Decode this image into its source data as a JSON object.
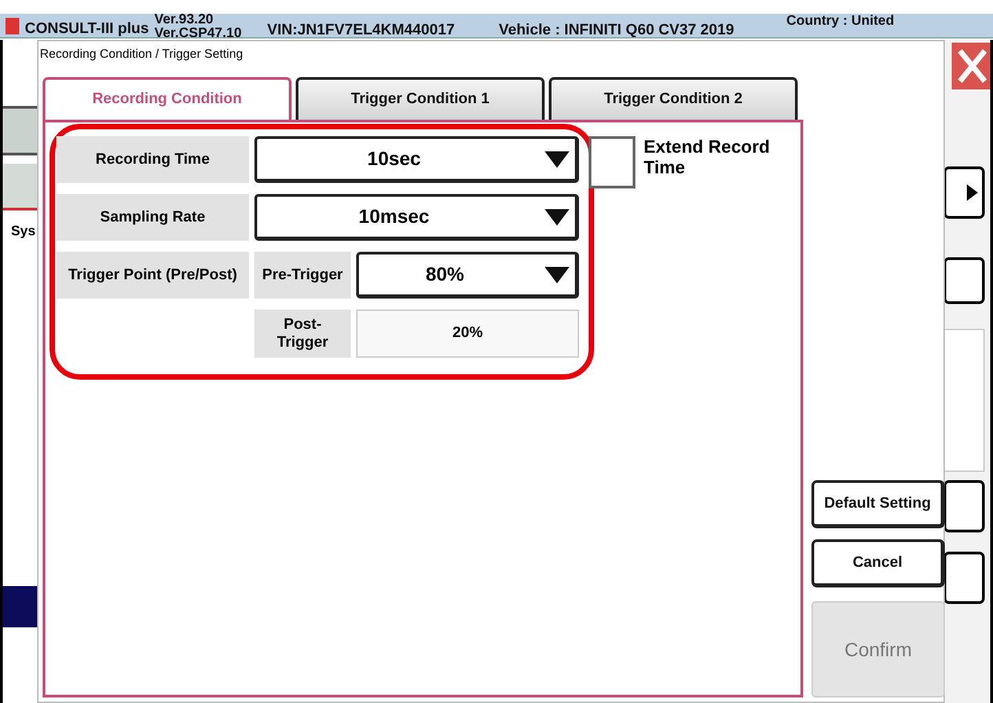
{
  "app_header": {
    "title": "CONSULT-III plus",
    "version_lines": [
      "Ver.93.20",
      "Ver.CSP47.10"
    ],
    "vin": "VIN:JN1FV7EL4KM440017",
    "vehicle": "Vehicle : INFINITI Q60 CV37 2019",
    "country": "Country : United"
  },
  "background": {
    "sidebar_label": "Sys"
  },
  "dialog": {
    "title": "Recording Condition / Trigger Setting",
    "tabs": [
      {
        "label": "Recording Condition",
        "selected": true
      },
      {
        "label": "Trigger Condition 1",
        "selected": false
      },
      {
        "label": "Trigger Condition 2",
        "selected": false
      }
    ],
    "fields": [
      {
        "kind": "dropdown",
        "label": "Recording Time",
        "value": "10sec"
      },
      {
        "kind": "dropdown",
        "label": "Sampling Rate",
        "value": "10msec"
      },
      {
        "kind": "split",
        "label": "Trigger Point (Pre/Post)",
        "pre_label": "Pre-Trigger",
        "pre_value": "80%",
        "post_label": "Post-Trigger",
        "post_value": "20%"
      }
    ],
    "extend_record_time": {
      "label": "Extend Record Time",
      "checked": false
    },
    "buttons": [
      {
        "label": "Default Setting",
        "disabled": false
      },
      {
        "label": "Cancel",
        "disabled": false
      },
      {
        "label": "Confirm",
        "disabled": true
      }
    ]
  }
}
